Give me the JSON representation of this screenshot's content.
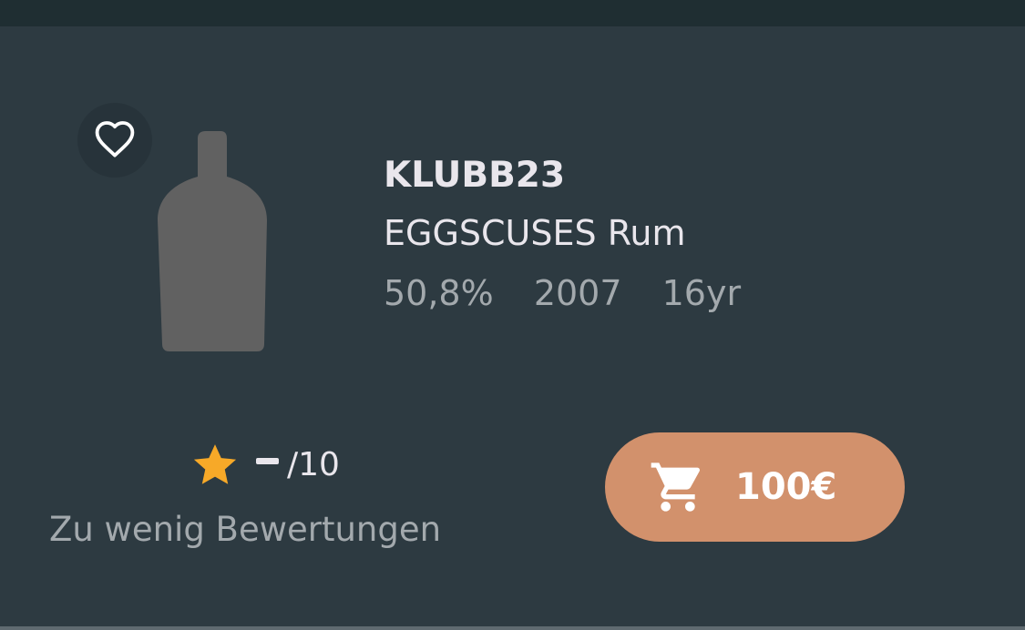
{
  "product": {
    "producer": "KLUBB23",
    "name": "EGGSCUSES Rum",
    "abv": "50,8%",
    "vintage": "2007",
    "age": "16yr"
  },
  "rating": {
    "value": "–",
    "scale": "/10",
    "note": "Zu wenig Bewertungen"
  },
  "buy": {
    "price": "100€"
  },
  "colors": {
    "background": "#2d3a41",
    "accent": "#d2916c",
    "star": "#f7a928",
    "bottle": "#616161"
  },
  "icons": {
    "favorite": "heart-outline-icon",
    "rating": "star-icon",
    "buy": "shopping-cart-icon",
    "image_placeholder": "bottle-icon"
  }
}
